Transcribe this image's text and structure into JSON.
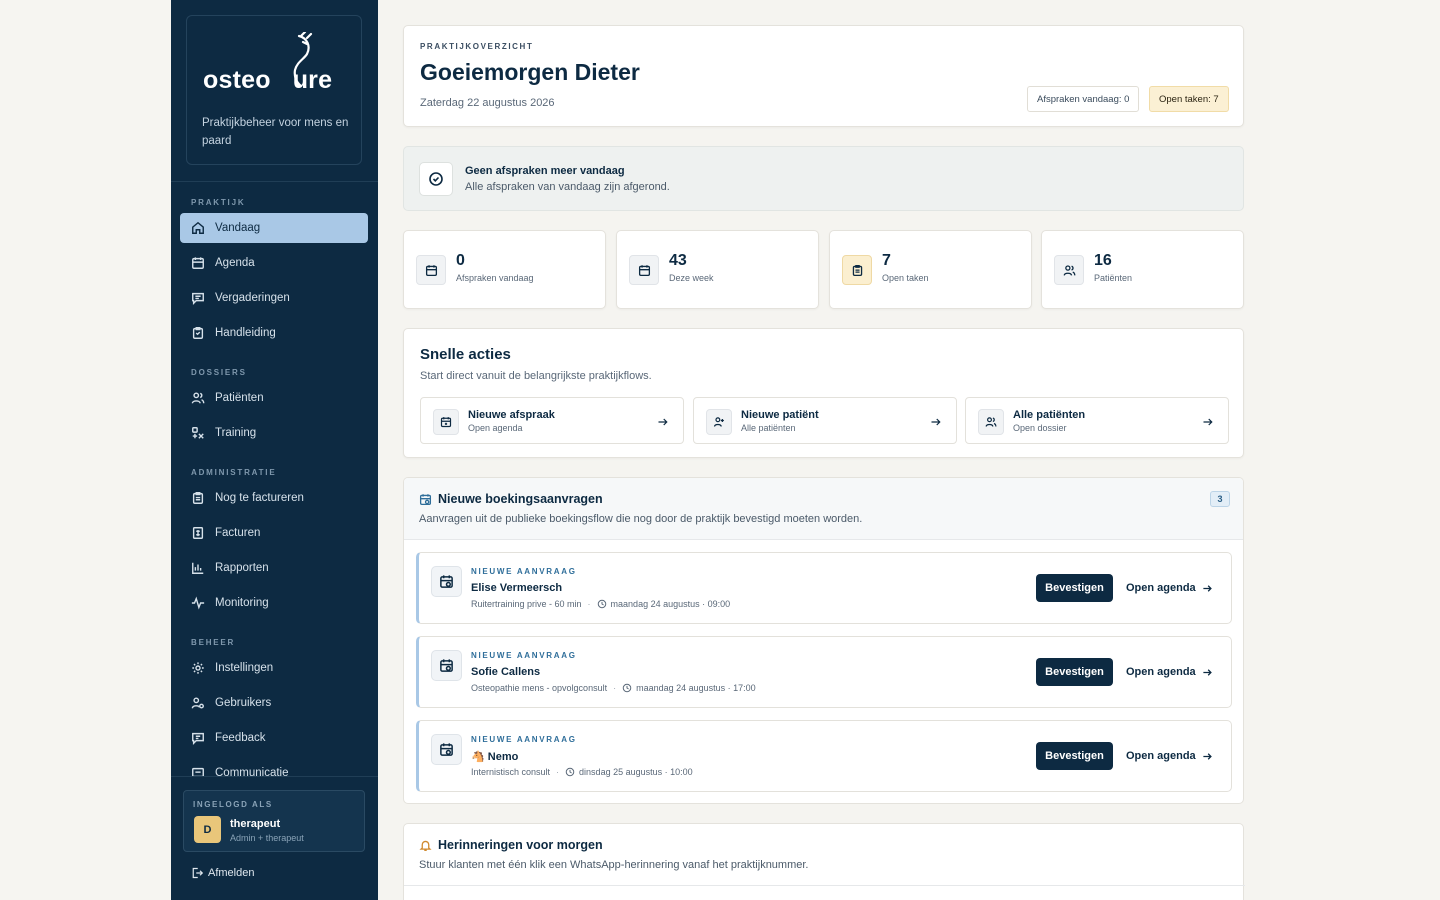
{
  "brand": {
    "logo_text": "osteoCure",
    "tagline": "Praktijkbeheer voor mens en paard"
  },
  "sidebar": {
    "sections": {
      "praktijk": "PRAKTIJK",
      "dossiers": "DOSSIERS",
      "administratie": "ADMINISTRATIE",
      "beheer": "BEHEER"
    },
    "items": [
      {
        "label": "Vandaag",
        "icon": "home-icon",
        "active": true
      },
      {
        "label": "Agenda",
        "icon": "calendar-icon"
      },
      {
        "label": "Vergaderingen",
        "icon": "chat-icon"
      },
      {
        "label": "Handleiding",
        "icon": "clipboard-icon"
      },
      {
        "label": "Patiënten",
        "icon": "users-icon"
      },
      {
        "label": "Training",
        "icon": "training-icon"
      },
      {
        "label": "Nog te factureren",
        "icon": "clipboard-list-icon"
      },
      {
        "label": "Facturen",
        "icon": "invoice-icon"
      },
      {
        "label": "Rapporten",
        "icon": "bar-chart-icon"
      },
      {
        "label": "Monitoring",
        "icon": "activity-icon"
      },
      {
        "label": "Instellingen",
        "icon": "gear-icon"
      },
      {
        "label": "Gebruikers",
        "icon": "users-settings-icon"
      },
      {
        "label": "Feedback",
        "icon": "feedback-icon"
      },
      {
        "label": "Communicatie",
        "icon": "message-icon"
      }
    ],
    "login": {
      "heading": "INGELOGD ALS",
      "initial": "D",
      "name": "therapeut",
      "role": "Admin + therapeut"
    },
    "logout_label": "Afmelden"
  },
  "header": {
    "eyebrow": "PRAKTIJKOVERZICHT",
    "title": "Goeiemorgen Dieter",
    "date": "Zaterdag 22 augustus 2026",
    "pill_appointments": "Afspraken vandaag: 0",
    "pill_tasks": "Open taken: 7"
  },
  "banner": {
    "title": "Geen afspraken meer vandaag",
    "subtitle": "Alle afspraken van vandaag zijn afgerond."
  },
  "stats": [
    {
      "value": "0",
      "label": "Afspraken vandaag",
      "icon": "calendar-icon"
    },
    {
      "value": "43",
      "label": "Deze week",
      "icon": "calendar-icon"
    },
    {
      "value": "7",
      "label": "Open taken",
      "icon": "clipboard-icon"
    },
    {
      "value": "16",
      "label": "Patiënten",
      "icon": "users-icon"
    }
  ],
  "quick_actions": {
    "title": "Snelle acties",
    "subtitle": "Start direct vanuit de belangrijkste praktijkflows.",
    "items": [
      {
        "title": "Nieuwe afspraak",
        "subtitle": "Open agenda",
        "icon": "calendar-plus-icon"
      },
      {
        "title": "Nieuwe patiënt",
        "subtitle": "Alle patiënten",
        "icon": "user-plus-icon"
      },
      {
        "title": "Alle patiënten",
        "subtitle": "Open dossier",
        "icon": "users-icon"
      }
    ]
  },
  "booking_requests": {
    "title": "Nieuwe boekingsaanvragen",
    "subtitle": "Aanvragen uit de publieke boekingsflow die nog door de praktijk bevestigd moeten worden.",
    "count": "3",
    "confirm_label": "Bevestigen",
    "agenda_label": "Open agenda",
    "items": [
      {
        "eyebrow": "NIEUWE AANVRAAG",
        "name": "Elise Vermeersch",
        "service": "Ruitertraining prive - 60 min",
        "when": "maandag 24 augustus · 09:00"
      },
      {
        "eyebrow": "NIEUWE AANVRAAG",
        "name": "Sofie Callens",
        "service": "Osteopathie mens - opvolgconsult",
        "when": "maandag 24 augustus · 17:00"
      },
      {
        "eyebrow": "NIEUWE AANVRAAG",
        "name": "🐴 Nemo",
        "service": "Internistisch consult",
        "when": "dinsdag 25 augustus · 10:00"
      }
    ]
  },
  "reminders": {
    "title": "Herinneringen voor morgen",
    "subtitle": "Stuur klanten met één klik een WhatsApp-herinnering vanaf het praktijknummer."
  },
  "colors": {
    "sidebar_bg": "#0d2a42",
    "active_nav": "#a9c8e6",
    "accent_warn": "#fbf0d4",
    "primary_button": "#0d2a42"
  }
}
